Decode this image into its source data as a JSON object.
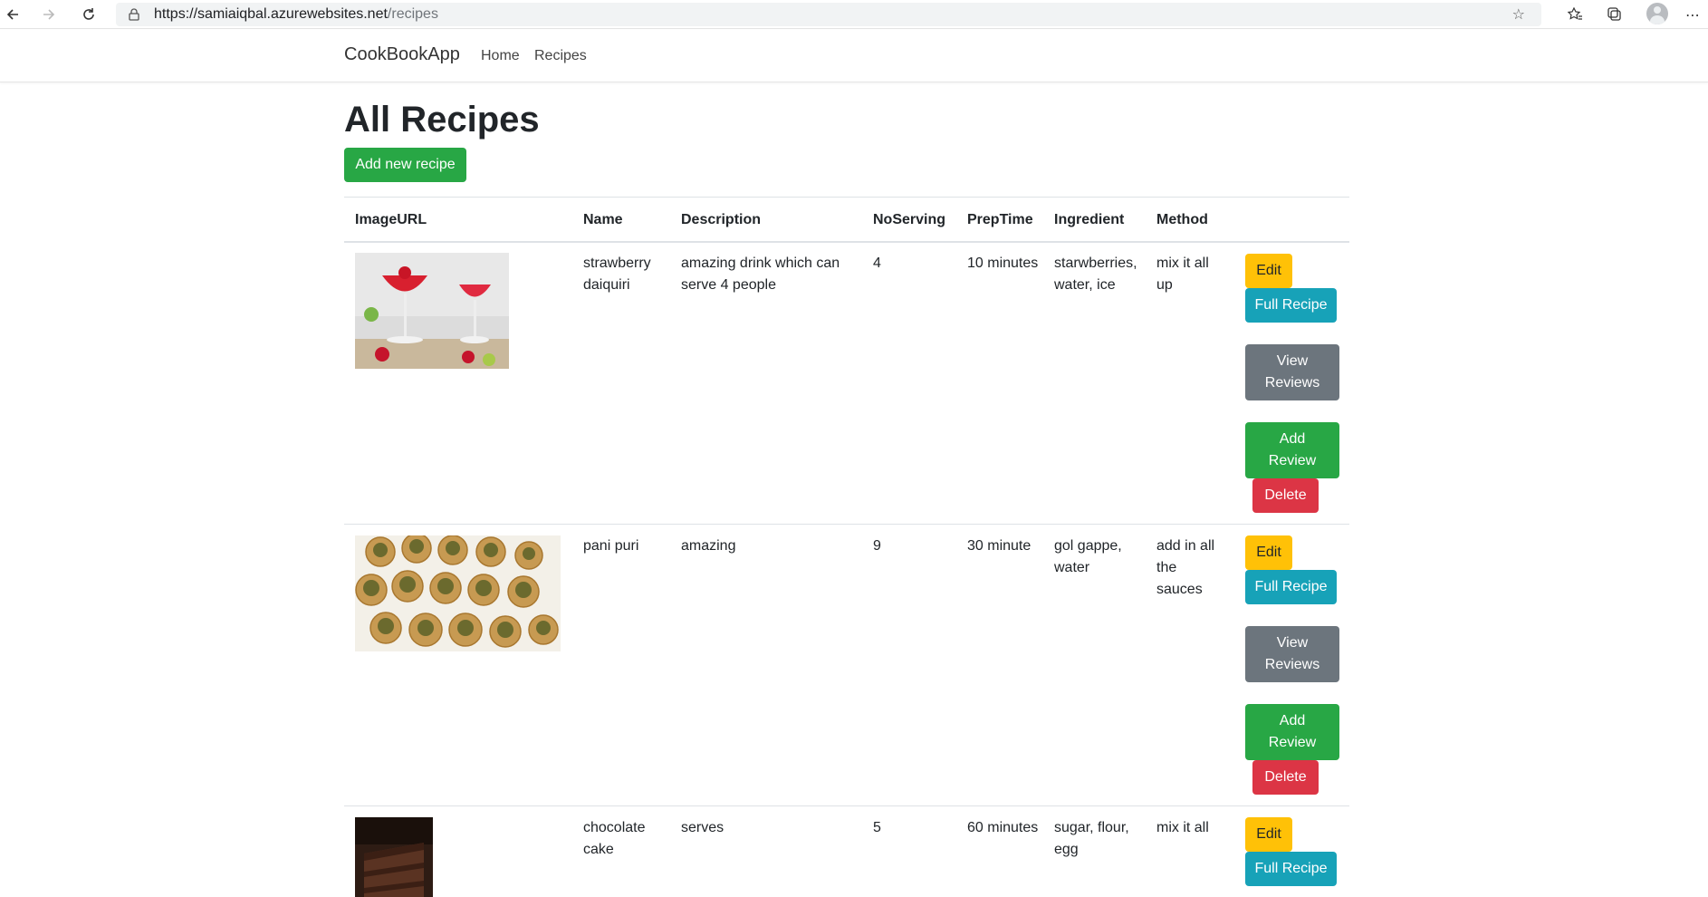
{
  "browser": {
    "url_host": "https://samiaiqbal.azurewebsites.net",
    "url_path": "/recipes"
  },
  "navbar": {
    "brand": "CookBookApp",
    "links": [
      "Home",
      "Recipes"
    ]
  },
  "page": {
    "title": "All Recipes",
    "add_button": "Add new recipe"
  },
  "table": {
    "headers": [
      "ImageURL",
      "Name",
      "Description",
      "NoServing",
      "PrepTime",
      "Ingredient",
      "Method"
    ],
    "rows": [
      {
        "image": "strawberry-daiquiri-photo",
        "name": "strawberry daiquiri",
        "description": "amazing drink which can serve 4 people",
        "noserving": "4",
        "preptime": "10 minutes",
        "ingredient": "starwberries, water, ice",
        "method": "mix it all up"
      },
      {
        "image": "pani-puri-photo",
        "name": "pani puri",
        "description": "amazing",
        "noserving": "9",
        "preptime": "30 minute",
        "ingredient": "gol gappe, water",
        "method": "add in all the sauces"
      },
      {
        "image": "chocolate-cake-photo",
        "name": "chocolate cake",
        "description": "serves",
        "noserving": "5",
        "preptime": "60 minutes",
        "ingredient": "sugar, flour, egg",
        "method": "mix it all"
      }
    ],
    "actions": {
      "edit": "Edit",
      "full": "Full Recipe",
      "view": "View Reviews",
      "add_review": "Add Review",
      "delete": "Delete"
    }
  },
  "colors": {
    "success": "#28a745",
    "info": "#17a2b8",
    "warning": "#ffc107",
    "secondary": "#6c757d",
    "danger": "#dc3545"
  }
}
